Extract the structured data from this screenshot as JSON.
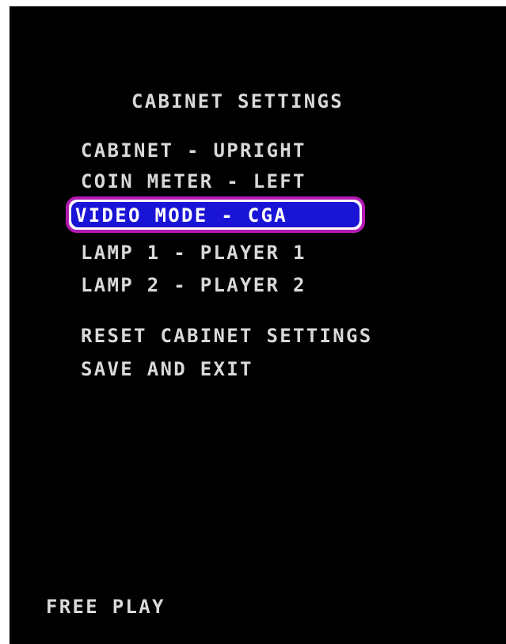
{
  "screen": {
    "title": "CABINET SETTINGS",
    "menu": [
      {
        "label": "CABINET - UPRIGHT"
      },
      {
        "label": "COIN METER - LEFT"
      },
      {
        "label": "VIDEO MODE - CGA",
        "selected": true
      },
      {
        "label": "LAMP 1 - PLAYER 1"
      },
      {
        "label": "LAMP 2 - PLAYER 2"
      },
      {
        "label": "RESET CABINET SETTINGS"
      },
      {
        "label": "SAVE AND EXIT"
      }
    ],
    "footer": "FREE PLAY"
  },
  "colors": {
    "background": "#000000",
    "text": "#d9d9d9",
    "highlight_fill": "#1a14d6",
    "highlight_border": "#b51ab5",
    "highlight_outline": "#ffffff"
  }
}
